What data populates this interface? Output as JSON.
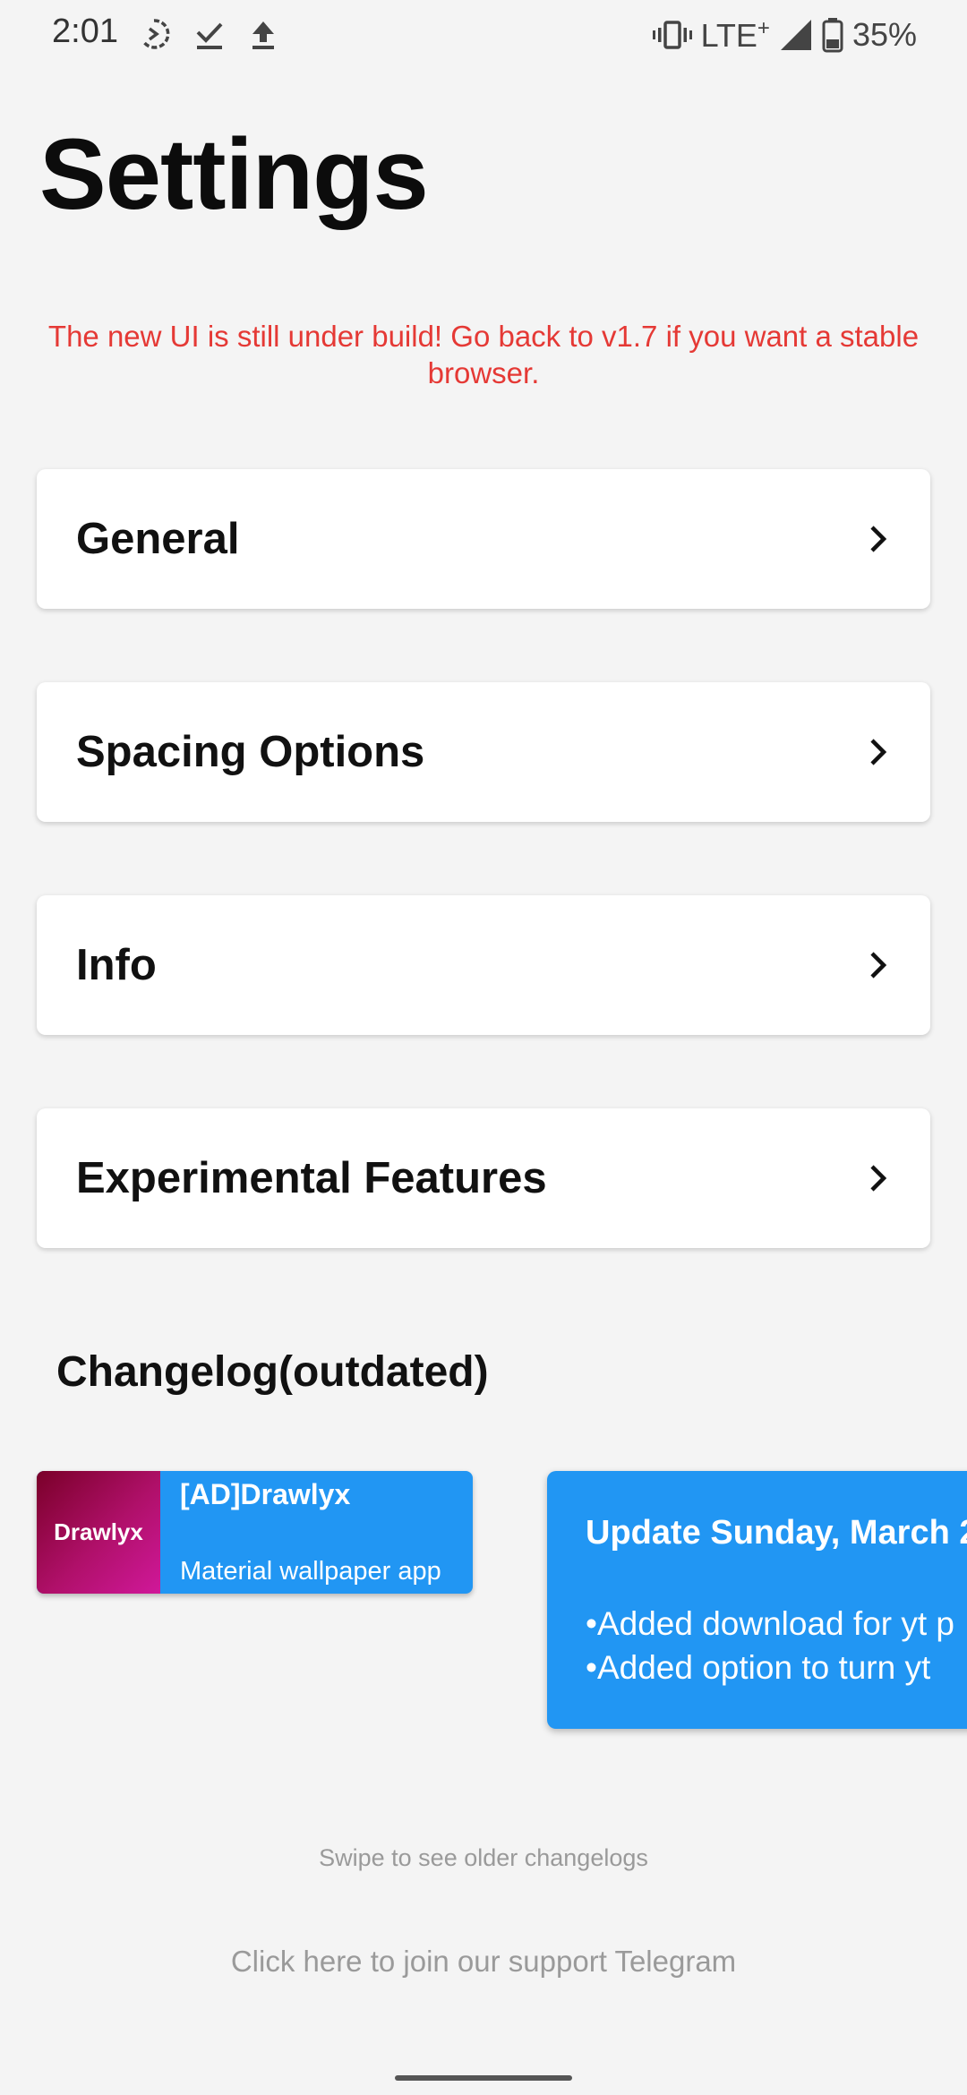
{
  "status_bar": {
    "time": "2:01",
    "network": "LTE",
    "network_plus": "+",
    "battery_percent": "35%",
    "icons": [
      "data-saver-icon",
      "download-done-icon",
      "upload-icon",
      "vibrate-icon",
      "signal-icon",
      "battery-icon"
    ]
  },
  "page": {
    "title": "Settings",
    "warning": "The new UI is still under build! Go back to v1.7 if you want a stable browser."
  },
  "menu": {
    "items": [
      {
        "label": "General"
      },
      {
        "label": "Spacing Options"
      },
      {
        "label": "Info"
      },
      {
        "label": "Experimental Features"
      }
    ]
  },
  "changelog": {
    "section_title": "Changelog(outdated)",
    "ad": {
      "logo_text": "Drawlyx",
      "title": "[AD]Drawlyx",
      "subtitle": "Material wallpaper app"
    },
    "entry": {
      "title": "Update Sunday, March 2",
      "items": [
        "•Added download for yt p",
        "•Added option to turn yt"
      ]
    },
    "swipe_hint": "Swipe to see older changelogs"
  },
  "footer": {
    "telegram_link": "Click here to join our support Telegram"
  },
  "colors": {
    "background": "#f4f4f4",
    "warning": "#e53935",
    "accent_blue": "#2196f3"
  }
}
